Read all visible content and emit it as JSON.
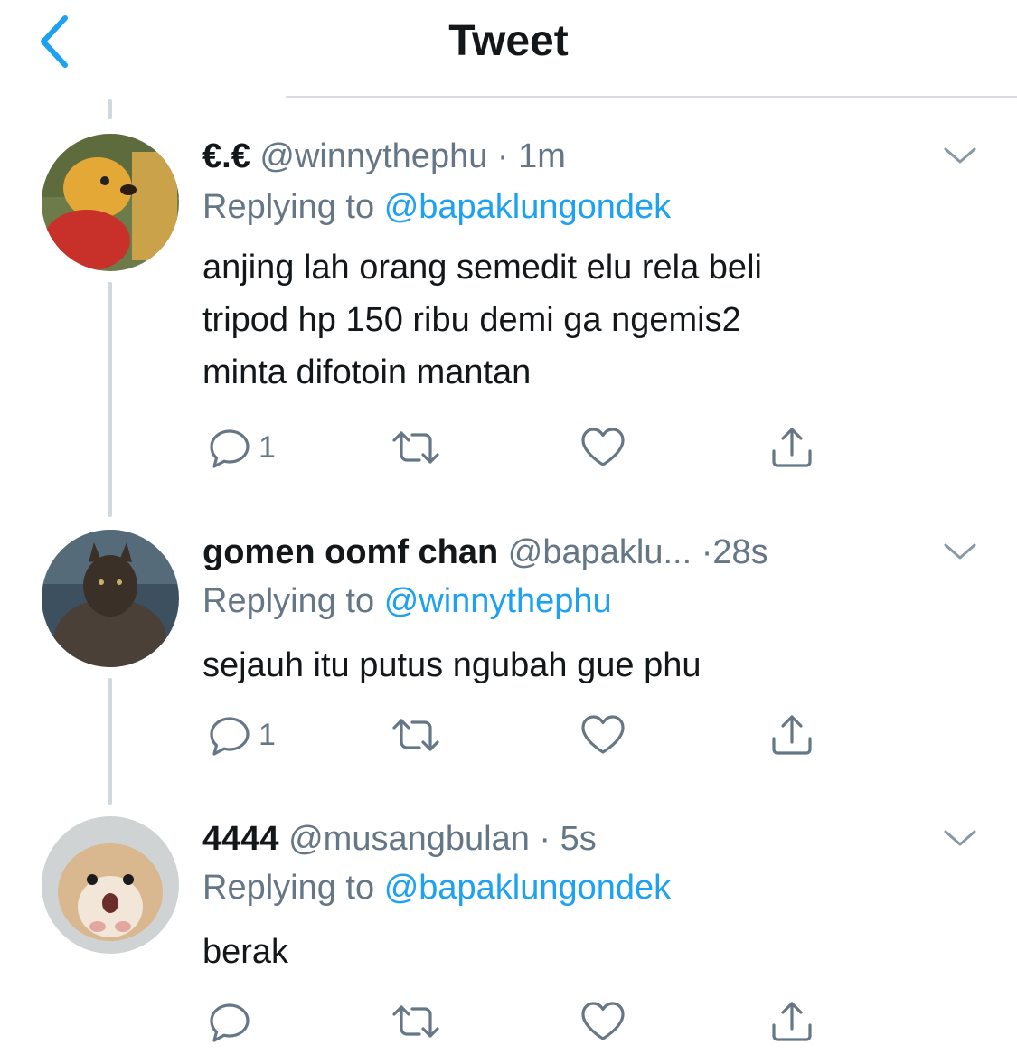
{
  "header": {
    "title": "Tweet",
    "back_icon": "chevron-left-icon",
    "accent": "#1da1f2"
  },
  "colors": {
    "text": "#14171a",
    "muted": "#657786",
    "link": "#1da1f2",
    "thread_line": "#cfd9de"
  },
  "tweets": [
    {
      "name": "€.€",
      "handle": "@winnythephu",
      "separator": "·",
      "time": "1m",
      "replying_prefix": "Replying to",
      "replying_to": "@bapaklungondek",
      "lines": [
        "anjing lah orang semedit elu rela beli",
        "tripod hp 150 ribu demi ga ngemis2",
        "minta difotoin mantan"
      ],
      "reply_count": "1"
    },
    {
      "name": "gomen oomf chan",
      "handle": "@bapaklu...",
      "separator": "·",
      "time": "28s",
      "replying_prefix": "Replying to",
      "replying_to": "@winnythephu",
      "lines": [
        "sejauh itu putus ngubah gue phu"
      ],
      "reply_count": "1"
    },
    {
      "name": "4444",
      "handle": "@musangbulan",
      "separator": "·",
      "time": "5s",
      "replying_prefix": "Replying to",
      "replying_to": "@bapaklungondek",
      "lines": [
        "berak"
      ],
      "reply_count": ""
    }
  ],
  "action_icons": [
    "reply-icon",
    "retweet-icon",
    "like-icon",
    "share-icon"
  ]
}
